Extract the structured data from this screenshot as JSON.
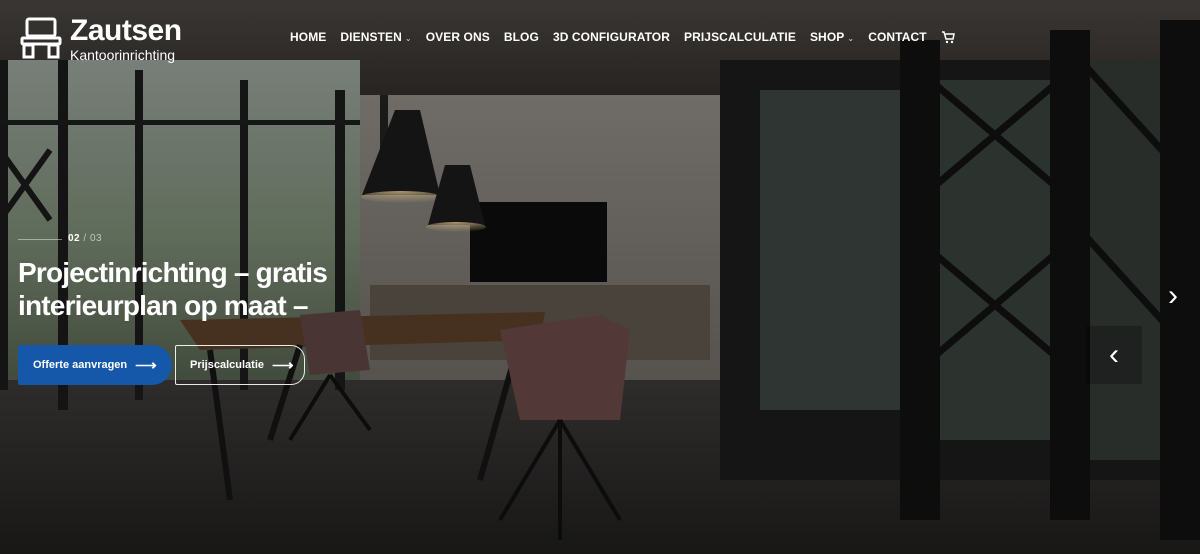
{
  "brand": {
    "name": "Zautsen",
    "tagline": "Kantoorinrichting"
  },
  "nav": {
    "items": [
      {
        "label": "HOME",
        "has_dropdown": false
      },
      {
        "label": "DIENSTEN",
        "has_dropdown": true
      },
      {
        "label": "OVER ONS",
        "has_dropdown": false
      },
      {
        "label": "BLOG",
        "has_dropdown": false
      },
      {
        "label": "3D CONFIGURATOR",
        "has_dropdown": false
      },
      {
        "label": "PRIJSCALCULATIE",
        "has_dropdown": false
      },
      {
        "label": "SHOP",
        "has_dropdown": true
      },
      {
        "label": "CONTACT",
        "has_dropdown": false
      }
    ],
    "cart_icon": "cart-icon"
  },
  "slide": {
    "current": "02",
    "separator": "/",
    "total": "03",
    "heading": "Projectinrichting – gratis interieurplan op maat –",
    "primary_button": "Offerte aanvragen",
    "secondary_button": "Prijscalculatie",
    "arrow_glyph": "⟶",
    "next_glyph": "›",
    "prev_glyph": "‹"
  },
  "colors": {
    "accent": "#1557a8",
    "text": "#ffffff"
  }
}
